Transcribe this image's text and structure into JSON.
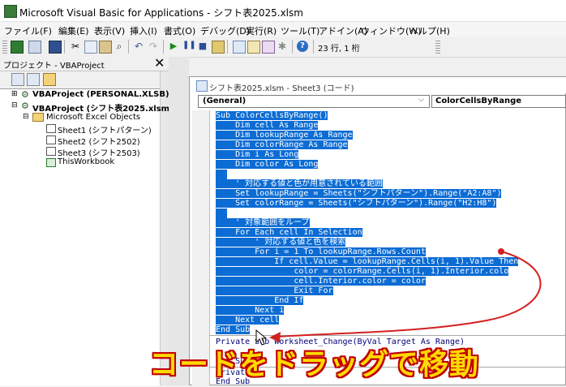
{
  "window": {
    "title": "Microsoft Visual Basic for Applications - シフト表2025.xlsm"
  },
  "menu": [
    "ファイル(F)",
    "編集(E)",
    "表示(V)",
    "挿入(I)",
    "書式(O)",
    "デバッグ(D)",
    "実行(R)",
    "ツール(T)",
    "アドイン(A)",
    "ウィンドウ(W)",
    "ヘルプ(H)"
  ],
  "toolbar": {
    "position": "23 行, 1 桁"
  },
  "project": {
    "title": "プロジェクト - VBAProject",
    "close": "✕",
    "tree": {
      "personal": "VBAProject (PERSONAL.XLSB)",
      "main": "VBAProject (シフト表2025.xlsm)",
      "folder": "Microsoft Excel Objects",
      "sheet1": "Sheet1 (シフトパターン)",
      "sheet2": "Sheet2 (シフト2502)",
      "sheet3": "Sheet3 (シフト2503)",
      "workbook": "ThisWorkbook"
    }
  },
  "code_window": {
    "title": "シフト表2025.xlsm - Sheet3 (コード)",
    "object_combo": "(General)",
    "proc_combo": "ColorCellsByRange",
    "lines": [
      "Sub ColorCellsByRange()",
      "    Dim cell As Range",
      "    Dim lookupRange As Range",
      "    Dim colorRange As Range",
      "    Dim i As Long",
      "    Dim color As Long",
      "",
      "    ' 対応する値と色が用意されている範囲",
      "    Set lookupRange = Sheets(\"シフトパターン\").Range(\"A2:A8\")",
      "    Set colorRange = Sheets(\"シフトパターン\").Range(\"H2:H8\")",
      "",
      "    ' 対象範囲をループ",
      "    For Each cell In Selection",
      "        ' 対応する値と色を検索",
      "        For i = 1 To lookupRange.Rows.Count",
      "            If cell.Value = lookupRange.Cells(i, 1).Value Then",
      "                color = colorRange.Cells(i, 1).Interior.colo",
      "                cell.Interior.color = color",
      "                Exit For",
      "            End If",
      "        Next i",
      "    Next cell",
      "End Sub",
      "Private Sub Worksheet_Change(ByVal Target As Range)",
      "",
      "End Sub",
      "Private Su",
      "End Sub"
    ]
  },
  "overlay": {
    "caption": "コードをドラッグで移動"
  },
  "colors": {
    "selection": "#0c6cd4",
    "caption_fill": "#ffd900",
    "caption_outline": "#c00000",
    "arrow": "#d42020"
  }
}
